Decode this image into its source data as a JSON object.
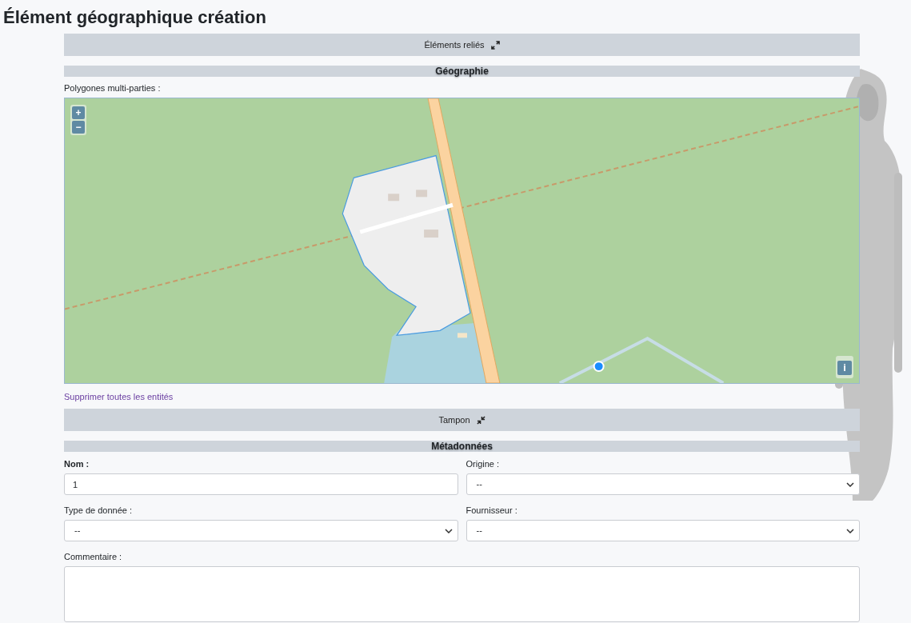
{
  "title": "Élément géographique création",
  "linked_section": {
    "label": "Éléments reliés",
    "expanded": false
  },
  "geography": {
    "heading": "Géographie",
    "field_label": "Polygones multi-parties :",
    "map": {
      "kind": "picture",
      "zoom_in": "+",
      "zoom_out": "−",
      "info": "i"
    },
    "clear_link": "Supprimer toutes les entités"
  },
  "buffer_section": {
    "label": "Tampon",
    "expanded": true
  },
  "metadata": {
    "heading": "Métadonnées",
    "fields": [
      {
        "kind": "input",
        "label": "Nom :",
        "required": true,
        "value": "1"
      },
      {
        "kind": "select",
        "label": "Origine :",
        "required": false,
        "value": "--"
      },
      {
        "kind": "select",
        "label": "Type de donnée :",
        "required": false,
        "value": "--"
      },
      {
        "kind": "select",
        "label": "Fournisseur :",
        "required": false,
        "value": "--"
      },
      {
        "kind": "textarea",
        "label": "Commentaire :",
        "required": false
      }
    ]
  }
}
